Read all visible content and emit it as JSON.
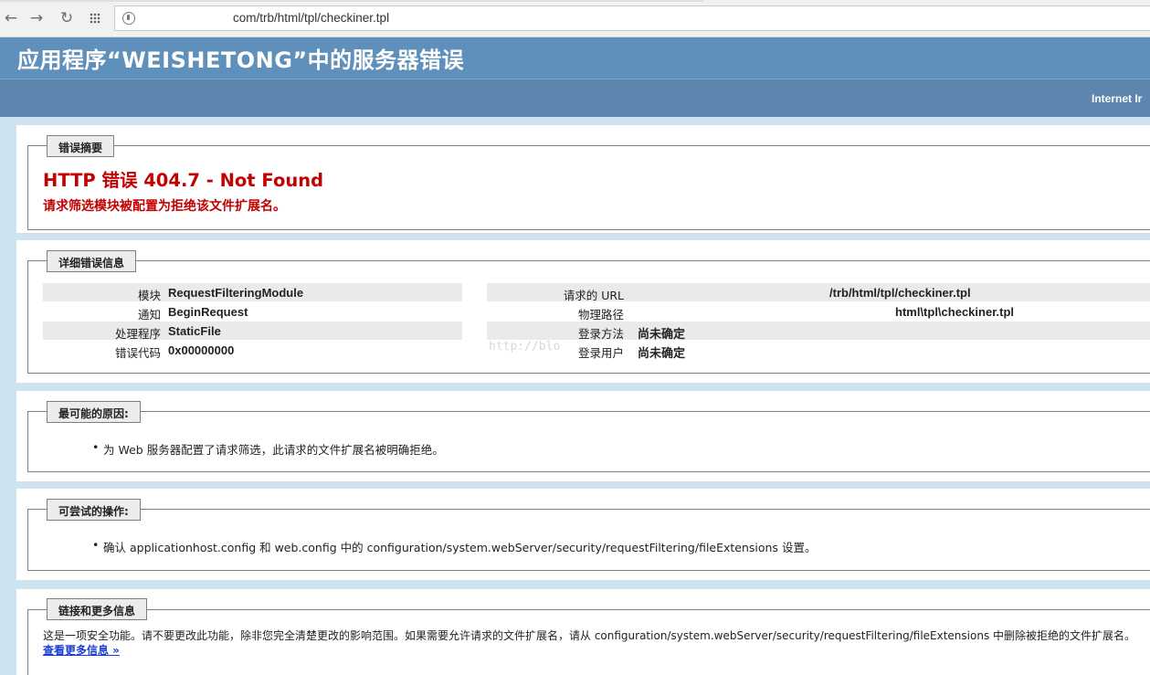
{
  "browser": {
    "url": "com/trb/html/tpl/checkiner.tpl",
    "icons": [
      "back-arrow-icon",
      "forward-arrow-icon",
      "reload-icon",
      "apps-grid-icon",
      "page-info-icon"
    ]
  },
  "header": {
    "title": "应用程序“WEISHETONG”中的服务器错误",
    "subtitle": "Internet Ir"
  },
  "summary": {
    "legend": "错误摘要",
    "error_title": "HTTP 错误 404.7 - Not Found",
    "error_description": "请求筛选模块被配置为拒绝该文件扩展名。",
    "accent_color": "#c20000"
  },
  "detail": {
    "legend": "详细错误信息",
    "left": [
      {
        "key": "模块",
        "value": "RequestFilteringModule"
      },
      {
        "key": "通知",
        "value": "BeginRequest"
      },
      {
        "key": "处理程序",
        "value": "StaticFile"
      },
      {
        "key": "错误代码",
        "value": "0x00000000"
      }
    ],
    "right": [
      {
        "key": "请求的 URL",
        "value": "/trb/html/tpl/checkiner.tpl"
      },
      {
        "key": "物理路径",
        "value": "html\\tpl\\checkiner.tpl"
      },
      {
        "key": "登录方法",
        "value": "尚未确定"
      },
      {
        "key": "登录用户",
        "value": "尚未确定"
      }
    ],
    "watermark": "http://blo"
  },
  "cause": {
    "legend": "最可能的原因:",
    "items": [
      "为 Web 服务器配置了请求筛选，此请求的文件扩展名被明确拒绝。"
    ]
  },
  "action": {
    "legend": "可尝试的操作:",
    "items": [
      "确认 applicationhost.config 和 web.config 中的 configuration/system.webServer/security/requestFiltering/fileExtensions 设置。"
    ]
  },
  "links": {
    "legend": "链接和更多信息",
    "text": "这是一项安全功能。请不要更改此功能，除非您完全清楚更改的影响范围。如果需要允许请求的文件扩展名，请从 configuration/system.webServer/security/requestFiltering/fileExtensions 中删除被拒绝的文件扩展名。",
    "more_info": "查看更多信息 »"
  }
}
